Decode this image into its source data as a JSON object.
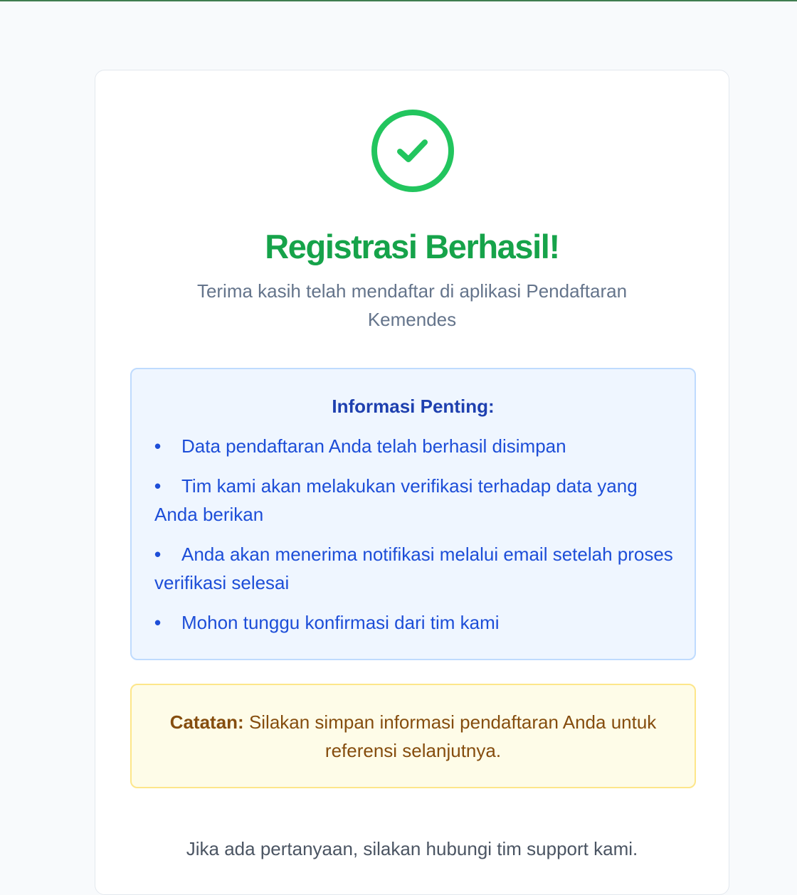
{
  "colors": {
    "success": "#22c55e",
    "title": "#16a34a",
    "info_text": "#1d4ed8",
    "info_bg": "#eff6ff",
    "note_text": "#854d0e",
    "note_bg": "#fefce8"
  },
  "icon": "check-circle-icon",
  "header": {
    "title": "Registrasi Berhasil!",
    "subtitle": "Terima kasih telah mendaftar di aplikasi Pendaftaran Kemendes"
  },
  "info": {
    "title": "Informasi Penting:",
    "bullet": "•",
    "items": [
      "Data pendaftaran Anda telah berhasil disimpan",
      "Tim kami akan melakukan verifikasi terhadap data yang Anda berikan",
      "Anda akan menerima notifikasi melalui email setelah proses verifikasi selesai",
      "Mohon tunggu konfirmasi dari tim kami"
    ]
  },
  "note": {
    "label": "Catatan:",
    "text": "Silakan simpan informasi pendaftaran Anda untuk referensi selanjutnya."
  },
  "footer": {
    "support_text": "Jika ada pertanyaan, silakan hubungi tim support kami."
  }
}
